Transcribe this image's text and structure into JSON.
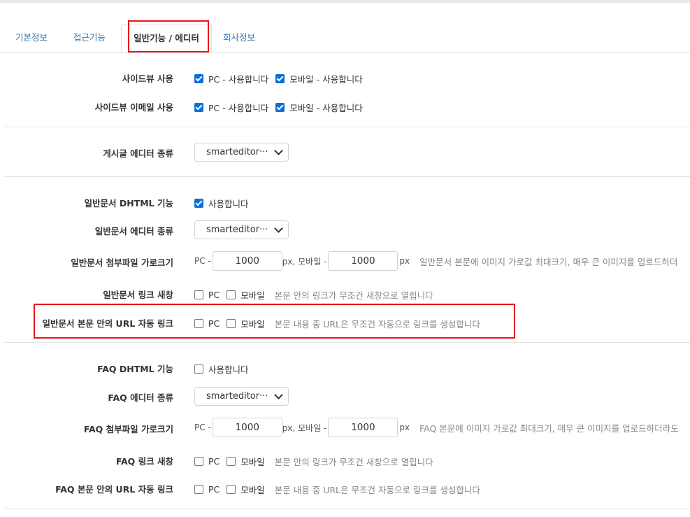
{
  "tabs": [
    "기본정보",
    "접근기능",
    "일반기능 / 에디터",
    "회사정보"
  ],
  "sideview": {
    "label": "사이드뷰 사용",
    "pc_label": "PC - 사용합니다",
    "pc_checked": true,
    "mobile_label": "모바일 - 사용합니다",
    "mobile_checked": true
  },
  "sideview_email": {
    "label": "사이드뷰 이메일 사용",
    "pc_label": "PC - 사용합니다",
    "pc_checked": true,
    "mobile_label": "모바일 - 사용합니다",
    "mobile_checked": true
  },
  "post_editor": {
    "label": "게시글 에디터 종류",
    "value": "smarteditor···"
  },
  "doc": {
    "dhtml": {
      "label": "일반문서 DHTML 기능",
      "option": "사용합니다",
      "checked": true
    },
    "editor": {
      "label": "일반문서 에디터 종류",
      "value": "smarteditor···"
    },
    "attach": {
      "label": "일반문서 첨부파일 가로크기",
      "pc_prefix": "PC -",
      "pc_value": "1000",
      "mid": "px, 모바일 -",
      "mobile_value": "1000",
      "unit": "px",
      "hint": "일반문서 본문에 이미지 가로값 최대크기, 매우 큰 이미지를 업로드하더"
    },
    "link_new": {
      "label": "일반문서 링크 새창",
      "pc": "PC",
      "mobile": "모바일",
      "hint": "본문 안의 링크가 무조건 새창으로 열립니다"
    },
    "url_auto": {
      "label": "일반문서 본문 안의 URL 자동 링크",
      "pc": "PC",
      "mobile": "모바일",
      "hint": "본문 내용 중 URL은 무조건 자동으로 링크를 생성합니다"
    }
  },
  "faq": {
    "dhtml": {
      "label": "FAQ DHTML 기능",
      "option": "사용합니다",
      "checked": false
    },
    "editor": {
      "label": "FAQ 에디터 종류",
      "value": "smarteditor···"
    },
    "attach": {
      "label": "FAQ 첨부파일 가로크기",
      "pc_prefix": "PC -",
      "pc_value": "1000",
      "mid": "px, 모바일 -",
      "mobile_value": "1000",
      "unit": "px",
      "hint": "FAQ 본문에 이미지 가로값 최대크기, 매우 큰 이미지를 업로드하더라도"
    },
    "link_new": {
      "label": "FAQ 링크 새창",
      "pc": "PC",
      "mobile": "모바일",
      "hint": "본문 안의 링크가 무조건 새창으로 열립니다"
    },
    "url_auto": {
      "label": "FAQ 본문 안의 URL 자동 링크",
      "pc": "PC",
      "mobile": "모바일",
      "hint": "본문 내용 중 URL은 무조건 자동으로 링크를 생성합니다"
    }
  },
  "colors": {
    "highlight": "#e8141c",
    "tab_link": "#2f7ab8",
    "checkbox_on": "#0b6fd8"
  }
}
